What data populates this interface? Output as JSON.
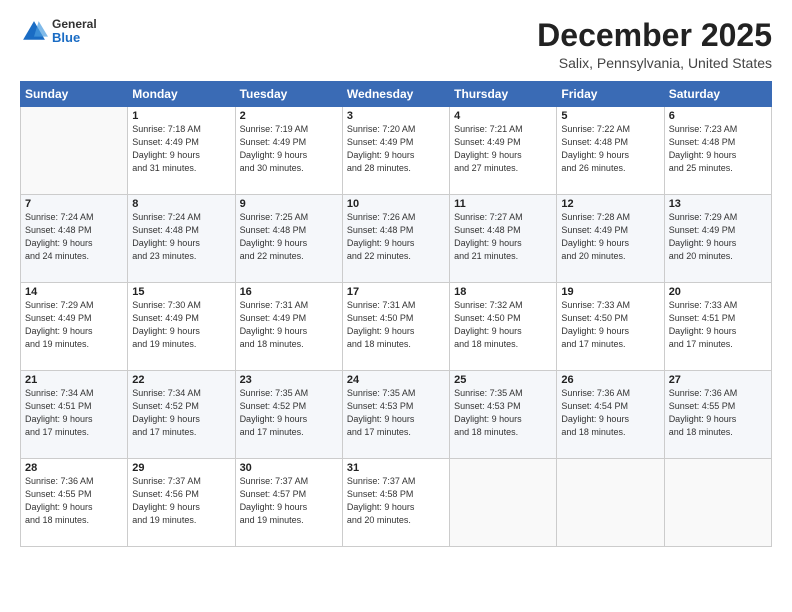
{
  "logo": {
    "general": "General",
    "blue": "Blue"
  },
  "title": "December 2025",
  "location": "Salix, Pennsylvania, United States",
  "days_header": [
    "Sunday",
    "Monday",
    "Tuesday",
    "Wednesday",
    "Thursday",
    "Friday",
    "Saturday"
  ],
  "weeks": [
    [
      {
        "day": "",
        "info": ""
      },
      {
        "day": "1",
        "info": "Sunrise: 7:18 AM\nSunset: 4:49 PM\nDaylight: 9 hours\nand 31 minutes."
      },
      {
        "day": "2",
        "info": "Sunrise: 7:19 AM\nSunset: 4:49 PM\nDaylight: 9 hours\nand 30 minutes."
      },
      {
        "day": "3",
        "info": "Sunrise: 7:20 AM\nSunset: 4:49 PM\nDaylight: 9 hours\nand 28 minutes."
      },
      {
        "day": "4",
        "info": "Sunrise: 7:21 AM\nSunset: 4:49 PM\nDaylight: 9 hours\nand 27 minutes."
      },
      {
        "day": "5",
        "info": "Sunrise: 7:22 AM\nSunset: 4:48 PM\nDaylight: 9 hours\nand 26 minutes."
      },
      {
        "day": "6",
        "info": "Sunrise: 7:23 AM\nSunset: 4:48 PM\nDaylight: 9 hours\nand 25 minutes."
      }
    ],
    [
      {
        "day": "7",
        "info": "Sunrise: 7:24 AM\nSunset: 4:48 PM\nDaylight: 9 hours\nand 24 minutes."
      },
      {
        "day": "8",
        "info": "Sunrise: 7:24 AM\nSunset: 4:48 PM\nDaylight: 9 hours\nand 23 minutes."
      },
      {
        "day": "9",
        "info": "Sunrise: 7:25 AM\nSunset: 4:48 PM\nDaylight: 9 hours\nand 22 minutes."
      },
      {
        "day": "10",
        "info": "Sunrise: 7:26 AM\nSunset: 4:48 PM\nDaylight: 9 hours\nand 22 minutes."
      },
      {
        "day": "11",
        "info": "Sunrise: 7:27 AM\nSunset: 4:48 PM\nDaylight: 9 hours\nand 21 minutes."
      },
      {
        "day": "12",
        "info": "Sunrise: 7:28 AM\nSunset: 4:49 PM\nDaylight: 9 hours\nand 20 minutes."
      },
      {
        "day": "13",
        "info": "Sunrise: 7:29 AM\nSunset: 4:49 PM\nDaylight: 9 hours\nand 20 minutes."
      }
    ],
    [
      {
        "day": "14",
        "info": "Sunrise: 7:29 AM\nSunset: 4:49 PM\nDaylight: 9 hours\nand 19 minutes."
      },
      {
        "day": "15",
        "info": "Sunrise: 7:30 AM\nSunset: 4:49 PM\nDaylight: 9 hours\nand 19 minutes."
      },
      {
        "day": "16",
        "info": "Sunrise: 7:31 AM\nSunset: 4:49 PM\nDaylight: 9 hours\nand 18 minutes."
      },
      {
        "day": "17",
        "info": "Sunrise: 7:31 AM\nSunset: 4:50 PM\nDaylight: 9 hours\nand 18 minutes."
      },
      {
        "day": "18",
        "info": "Sunrise: 7:32 AM\nSunset: 4:50 PM\nDaylight: 9 hours\nand 18 minutes."
      },
      {
        "day": "19",
        "info": "Sunrise: 7:33 AM\nSunset: 4:50 PM\nDaylight: 9 hours\nand 17 minutes."
      },
      {
        "day": "20",
        "info": "Sunrise: 7:33 AM\nSunset: 4:51 PM\nDaylight: 9 hours\nand 17 minutes."
      }
    ],
    [
      {
        "day": "21",
        "info": "Sunrise: 7:34 AM\nSunset: 4:51 PM\nDaylight: 9 hours\nand 17 minutes."
      },
      {
        "day": "22",
        "info": "Sunrise: 7:34 AM\nSunset: 4:52 PM\nDaylight: 9 hours\nand 17 minutes."
      },
      {
        "day": "23",
        "info": "Sunrise: 7:35 AM\nSunset: 4:52 PM\nDaylight: 9 hours\nand 17 minutes."
      },
      {
        "day": "24",
        "info": "Sunrise: 7:35 AM\nSunset: 4:53 PM\nDaylight: 9 hours\nand 17 minutes."
      },
      {
        "day": "25",
        "info": "Sunrise: 7:35 AM\nSunset: 4:53 PM\nDaylight: 9 hours\nand 18 minutes."
      },
      {
        "day": "26",
        "info": "Sunrise: 7:36 AM\nSunset: 4:54 PM\nDaylight: 9 hours\nand 18 minutes."
      },
      {
        "day": "27",
        "info": "Sunrise: 7:36 AM\nSunset: 4:55 PM\nDaylight: 9 hours\nand 18 minutes."
      }
    ],
    [
      {
        "day": "28",
        "info": "Sunrise: 7:36 AM\nSunset: 4:55 PM\nDaylight: 9 hours\nand 18 minutes."
      },
      {
        "day": "29",
        "info": "Sunrise: 7:37 AM\nSunset: 4:56 PM\nDaylight: 9 hours\nand 19 minutes."
      },
      {
        "day": "30",
        "info": "Sunrise: 7:37 AM\nSunset: 4:57 PM\nDaylight: 9 hours\nand 19 minutes."
      },
      {
        "day": "31",
        "info": "Sunrise: 7:37 AM\nSunset: 4:58 PM\nDaylight: 9 hours\nand 20 minutes."
      },
      {
        "day": "",
        "info": ""
      },
      {
        "day": "",
        "info": ""
      },
      {
        "day": "",
        "info": ""
      }
    ]
  ]
}
